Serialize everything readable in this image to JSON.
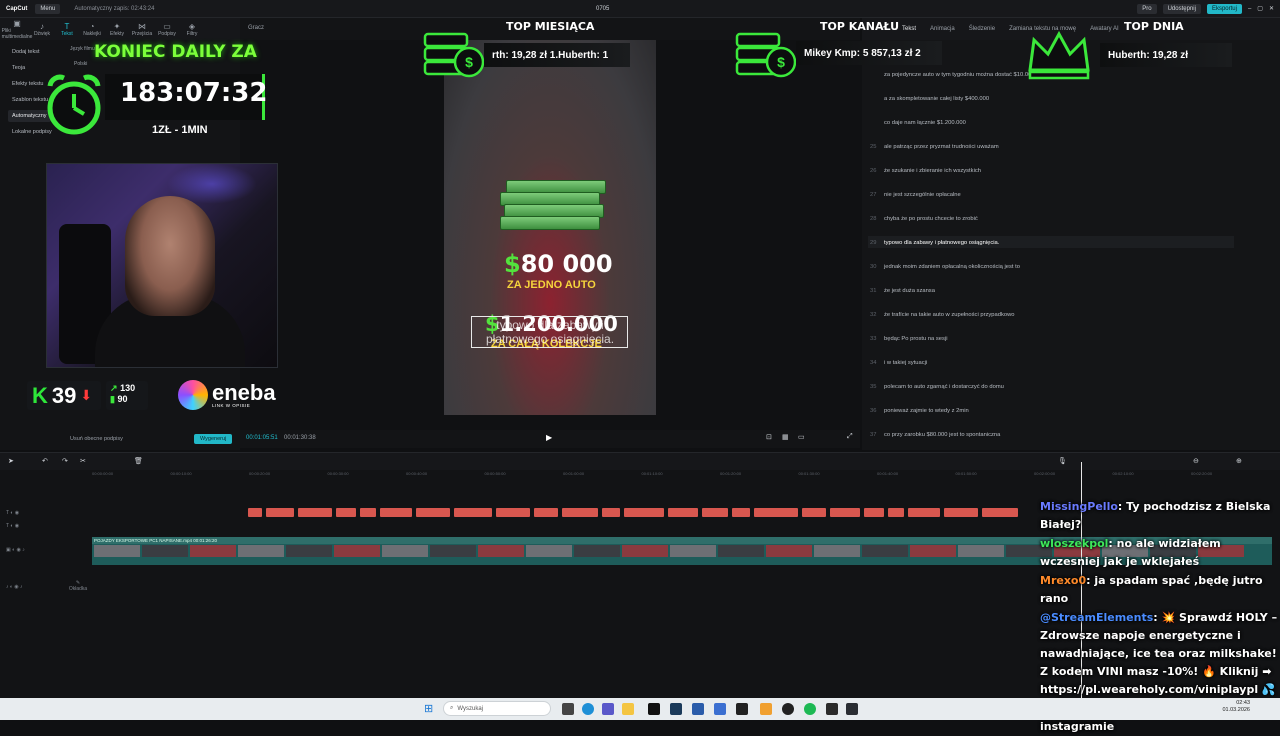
{
  "titlebar": {
    "logo": "CapCut",
    "menu": "Menu",
    "autosave": "Automatyczny zapis: 02:43:24",
    "project": "0705",
    "pro": "Pro",
    "share": "Udostępnij",
    "export": "Eksportuj"
  },
  "toolbar": {
    "items": [
      "Pliki multimedialne",
      "Dźwięk",
      "Tekst",
      "Naklejki",
      "Efekty",
      "Przejścia",
      "Podpisy",
      "Filtry"
    ]
  },
  "leftpanel": {
    "items": [
      "Dodaj tekst",
      "Teoja",
      "Efekty tekstu",
      "Szablon tekstu",
      "Automatyczny",
      "Lokalne podpisy"
    ],
    "lang_label": "Język filmu",
    "lang_value": "Polski",
    "remove_subs": "Usuń obecne podpisy",
    "generate": "Wygeneruj"
  },
  "overlay": {
    "daily_title": "KONIEC DAILY ZA",
    "timer": "183:07:32",
    "timer_sub": "1ZŁ - 1MIN",
    "k_value": "39",
    "stat_up": "130",
    "stat_down": "90",
    "sponsor": "eneba",
    "sponsor_sub": "LINK W OPISIE",
    "top_month": "TOP MIESIĄCA",
    "top_month_text": "rth: 19,28 zł    1.Huberth: 1",
    "top_channel": "TOP KANAŁU",
    "top_channel_text": "Mikey Kmp: 5 857,13 zł   2",
    "top_day": "TOP DNIA",
    "top_day_text": "Huberth: 19,28 zł"
  },
  "preview": {
    "player_label": "Gracz",
    "price1": "80 000",
    "price1_sub": "ZA JEDNO AUTO",
    "price2": "1.200.000",
    "price2_sub": "ZA CAŁĄ KOLEKCJE",
    "subtitle": "typowo dla zabawy i płatnowego osiągnięcia.",
    "time_current": "00:01:05:51",
    "time_total": "00:01:30:38"
  },
  "script_tabs": [
    "Tekst",
    "Animacja",
    "Śledzenie",
    "Zamiana tekstu na mowę",
    "Awatary AI"
  ],
  "script_lines": [
    {
      "num": "",
      "text": "za pojedyncze auto w tym tygodniu można dostać $10.000"
    },
    {
      "num": "",
      "text": "a za skompletowanie całej listy $400.000"
    },
    {
      "num": "",
      "text": "co daje nam łącznie $1.200.000"
    },
    {
      "num": "25",
      "text": "ale patrząc przez pryzmat trudności uważam"
    },
    {
      "num": "26",
      "text": "że szukanie i zbieranie ich wszystkich"
    },
    {
      "num": "27",
      "text": "nie jest szczególnie opłacalne"
    },
    {
      "num": "28",
      "text": "chyba że po prostu chcecie to zrobić"
    },
    {
      "num": "29",
      "text": "typowo dla zabawy i płatnowego osiągnięcia."
    },
    {
      "num": "30",
      "text": "jednak moim zdaniem opłacalną okolicznością jest to"
    },
    {
      "num": "31",
      "text": "że jest duża szansa"
    },
    {
      "num": "32",
      "text": "że trafície na takie auto w zupełności przypadkowo"
    },
    {
      "num": "33",
      "text": "będąc Po prostu na sesji"
    },
    {
      "num": "34",
      "text": "i w takiej sytuacji"
    },
    {
      "num": "35",
      "text": "polecam to auto zgarnąć i dostarczyć do domu"
    },
    {
      "num": "36",
      "text": "ponieważ zajmie to wtedy z 2min"
    },
    {
      "num": "37",
      "text": "co przy zarobku $80.000 jest to spontaniczna"
    }
  ],
  "timeline": {
    "video_label": "POJAZDY EKSPORTOWE PC1 NAPISANE.mp4  00:01:26:20",
    "cover_label": "Okładka",
    "ruler": [
      "00:00:00:00",
      "00:00:10:00",
      "00:00:20:00",
      "00:00:30:00",
      "00:00:40:00",
      "00:00:50:00",
      "00:01:00:00",
      "00:01:10:00",
      "00:01:20:00",
      "00:01:30:00",
      "00:01:40:00",
      "00:01:50:00",
      "00:02:00:00",
      "00:02:10:00",
      "00:02:20:00"
    ]
  },
  "chat": [
    {
      "user": "MissingPello",
      "color": "#6a7bff",
      "text": ": Ty pochodzisz z Bielska Białej?"
    },
    {
      "user": "wloszekpol",
      "color": "#3ee85a",
      "text": ": no ale widziałem wczesniej jak je wklejałeś"
    },
    {
      "user": "Mrexo0",
      "color": "#ff8a2a",
      "text": ": ja spadam spać ,będę jutro rano"
    },
    {
      "user": "@StreamElements",
      "color": "#4a8cff",
      "text": ": 💥 Sprawdź HOLY – Zdrowsze napoje energetyczne i nawadniające, ice tea oraz milkshake! Z kodem VINI masz -10%! 🔥 Kliknij ➡ https://pl.weareholy.com/viniplaypl 💦"
    },
    {
      "user": "MissingPello",
      "color": "#6a7bff",
      "text": ": Napisałem ci na priv na instagramie"
    }
  ],
  "taskbar": {
    "search_placeholder": "Wyszukaj",
    "time": "02:43",
    "date": "01.03.2026"
  }
}
